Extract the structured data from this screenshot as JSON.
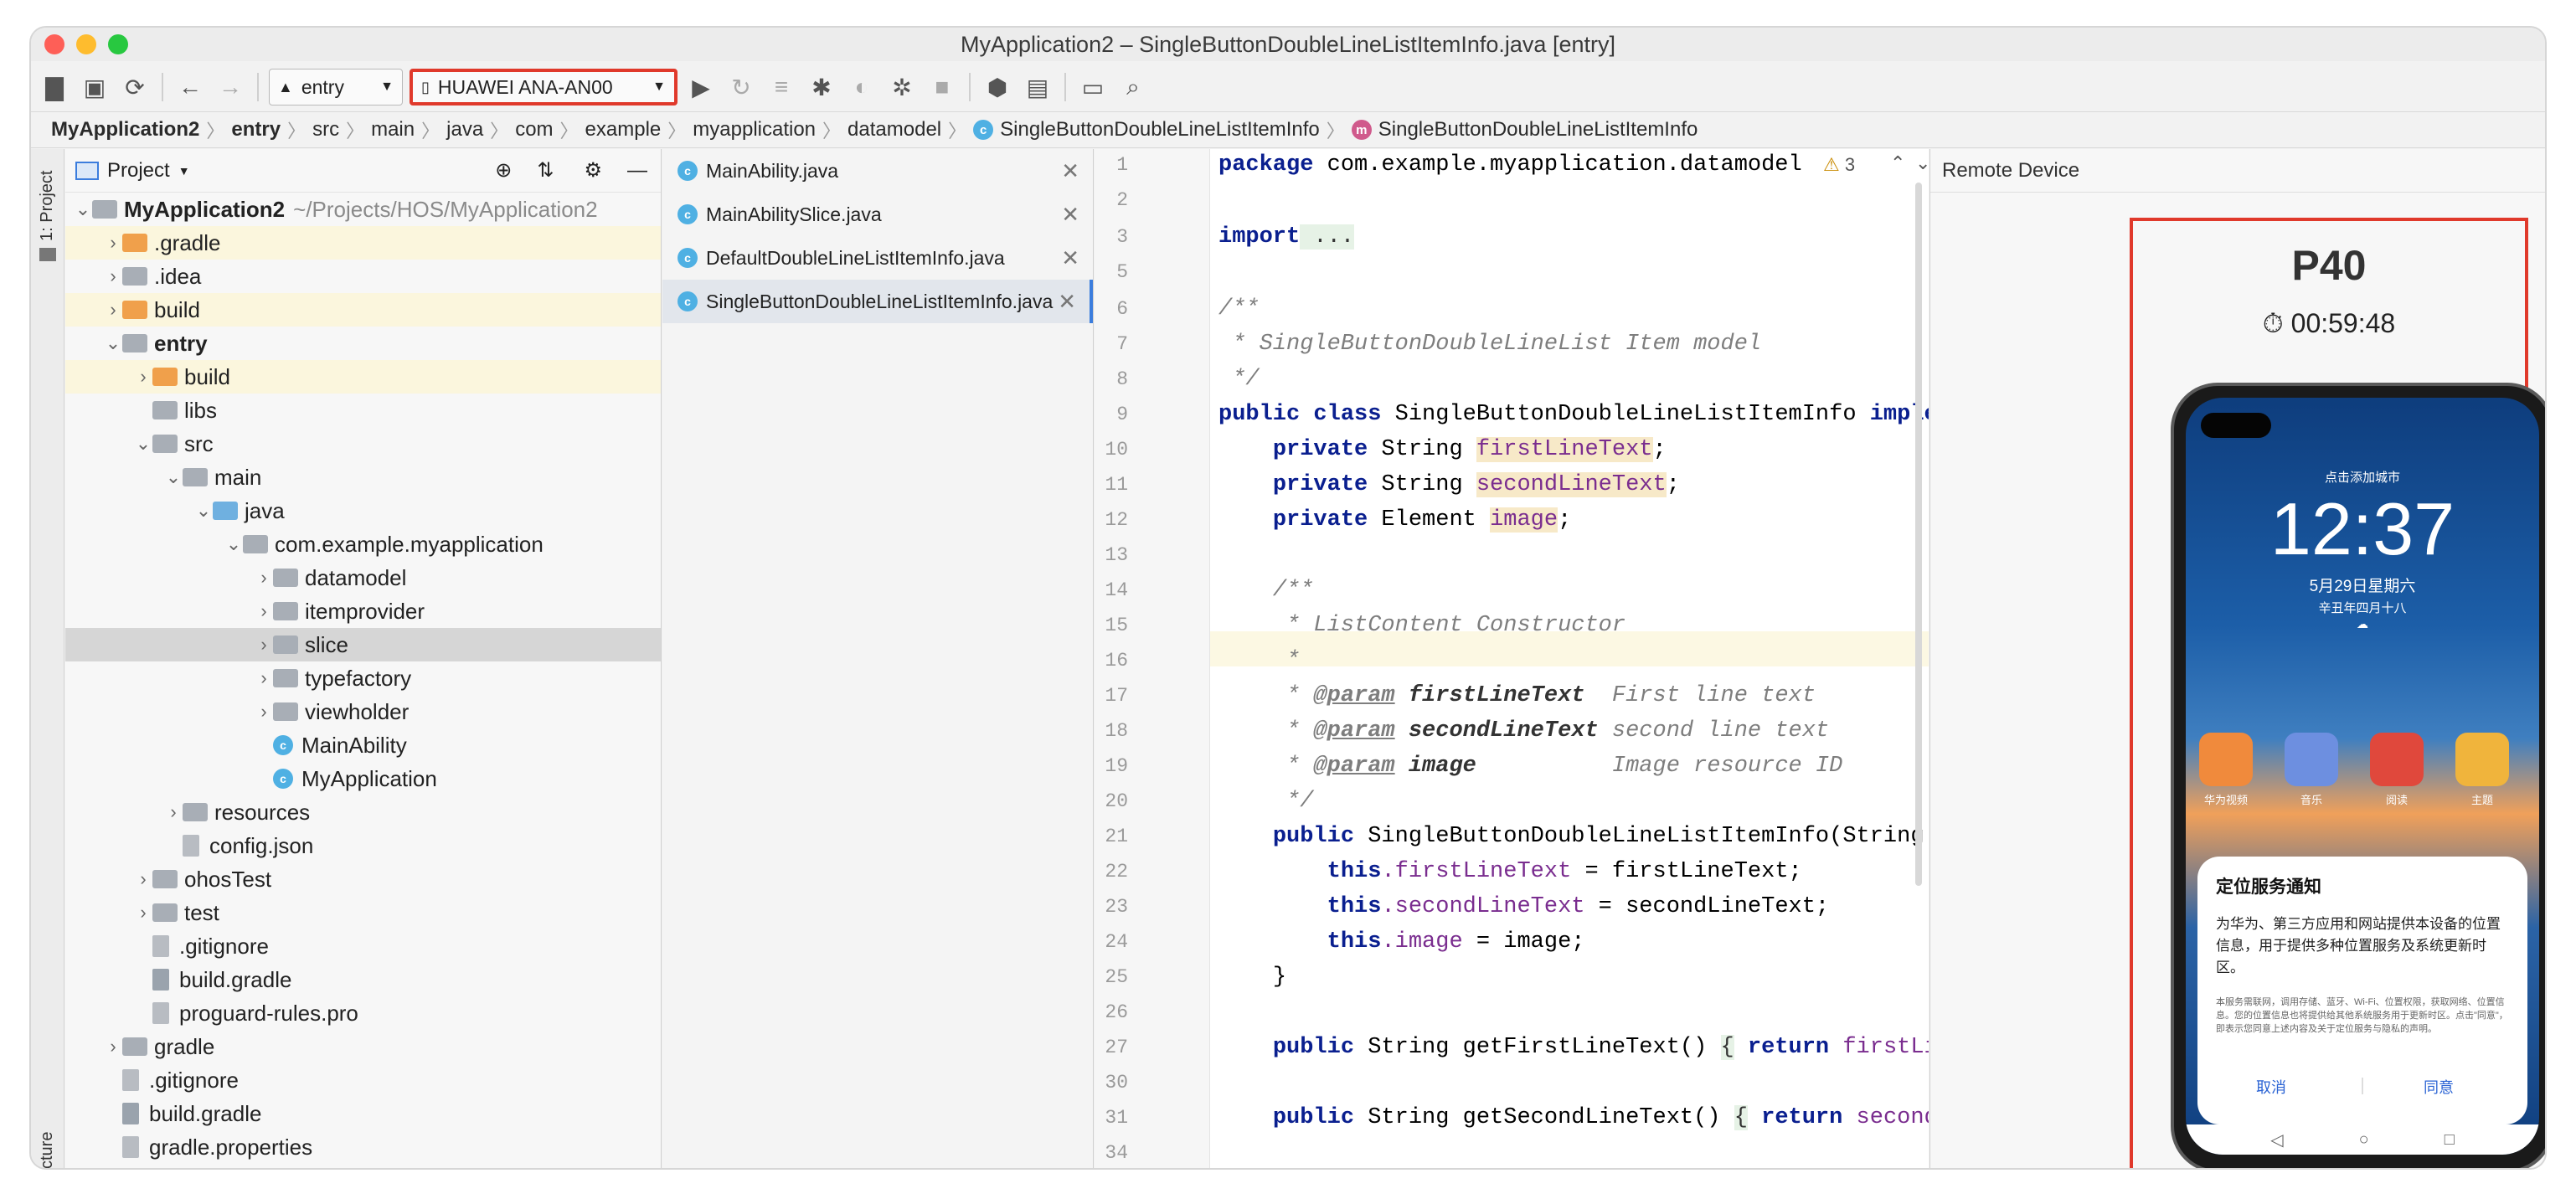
{
  "window": {
    "title": "MyApplication2 – SingleButtonDoubleLineListItemInfo.java [entry]"
  },
  "toolbar": {
    "module_combo": "entry",
    "device_combo": "HUAWEI ANA-AN00"
  },
  "breadcrumb": [
    "MyApplication2",
    "entry",
    "src",
    "main",
    "java",
    "com",
    "example",
    "myapplication",
    "datamodel",
    "SingleButtonDoubleLineListItemInfo",
    "SingleButtonDoubleLineListItemInfo"
  ],
  "sidebar": {
    "project_label": "1: Project",
    "structure_label": "cture"
  },
  "project": {
    "title": "Project",
    "tree": [
      {
        "label": "MyApplication2",
        "note": "~/Projects/HOS/MyApplication2",
        "depth": 0,
        "icon": "module",
        "expanded": true,
        "bold": true
      },
      {
        "label": ".gradle",
        "depth": 1,
        "icon": "folder-orange",
        "collapsed": true,
        "hl": true
      },
      {
        "label": ".idea",
        "depth": 1,
        "icon": "folder-grey",
        "collapsed": true
      },
      {
        "label": "build",
        "depth": 1,
        "icon": "folder-orange",
        "collapsed": true,
        "hl": true
      },
      {
        "label": "entry",
        "depth": 1,
        "icon": "module",
        "expanded": true,
        "bold": true
      },
      {
        "label": "build",
        "depth": 2,
        "icon": "folder-orange",
        "collapsed": true,
        "hl": true
      },
      {
        "label": "libs",
        "depth": 2,
        "icon": "folder-grey"
      },
      {
        "label": "src",
        "depth": 2,
        "icon": "folder-grey",
        "expanded": true
      },
      {
        "label": "main",
        "depth": 3,
        "icon": "folder-grey",
        "expanded": true
      },
      {
        "label": "java",
        "depth": 4,
        "icon": "folder-blue",
        "expanded": true
      },
      {
        "label": "com.example.myapplication",
        "depth": 5,
        "icon": "package",
        "expanded": true
      },
      {
        "label": "datamodel",
        "depth": 6,
        "icon": "package",
        "collapsed": true
      },
      {
        "label": "itemprovider",
        "depth": 6,
        "icon": "package",
        "collapsed": true
      },
      {
        "label": "slice",
        "depth": 6,
        "icon": "package",
        "collapsed": true,
        "sel": true
      },
      {
        "label": "typefactory",
        "depth": 6,
        "icon": "package",
        "collapsed": true
      },
      {
        "label": "viewholder",
        "depth": 6,
        "icon": "package",
        "collapsed": true
      },
      {
        "label": "MainAbility",
        "depth": 6,
        "icon": "class"
      },
      {
        "label": "MyApplication",
        "depth": 6,
        "icon": "class"
      },
      {
        "label": "resources",
        "depth": 3,
        "icon": "folder-grey",
        "collapsed": true
      },
      {
        "label": "config.json",
        "depth": 3,
        "icon": "file"
      },
      {
        "label": "ohosTest",
        "depth": 2,
        "icon": "folder-grey",
        "collapsed": true
      },
      {
        "label": "test",
        "depth": 2,
        "icon": "folder-grey",
        "collapsed": true
      },
      {
        "label": ".gitignore",
        "depth": 2,
        "icon": "file"
      },
      {
        "label": "build.gradle",
        "depth": 2,
        "icon": "gradle"
      },
      {
        "label": "proguard-rules.pro",
        "depth": 2,
        "icon": "file"
      },
      {
        "label": "gradle",
        "depth": 1,
        "icon": "folder-grey",
        "collapsed": true
      },
      {
        "label": ".gitignore",
        "depth": 1,
        "icon": "file"
      },
      {
        "label": "build.gradle",
        "depth": 1,
        "icon": "gradle"
      },
      {
        "label": "gradle.properties",
        "depth": 1,
        "icon": "file"
      }
    ]
  },
  "tabs": [
    {
      "label": "MainAbility.java"
    },
    {
      "label": "MainAbilitySlice.java"
    },
    {
      "label": "DefaultDoubleLineListItemInfo.java"
    },
    {
      "label": "SingleButtonDoubleLineListItemInfo.java",
      "active": true
    }
  ],
  "editor": {
    "inspection_count": "3",
    "lines": [
      {
        "n": "1",
        "html": "package"
      },
      {
        "n": "2"
      },
      {
        "n": "3"
      },
      {
        "n": "5"
      },
      {
        "n": "6"
      },
      {
        "n": "7"
      },
      {
        "n": "8"
      },
      {
        "n": "9"
      },
      {
        "n": "10"
      },
      {
        "n": "11"
      },
      {
        "n": "12"
      },
      {
        "n": "13"
      },
      {
        "n": "14"
      },
      {
        "n": "15"
      },
      {
        "n": "16"
      },
      {
        "n": "17"
      },
      {
        "n": "18"
      },
      {
        "n": "19"
      },
      {
        "n": "20"
      },
      {
        "n": "21"
      },
      {
        "n": "22"
      },
      {
        "n": "23"
      },
      {
        "n": "24"
      },
      {
        "n": "25"
      },
      {
        "n": "26"
      },
      {
        "n": "27"
      },
      {
        "n": "30"
      },
      {
        "n": "31"
      },
      {
        "n": "34"
      }
    ],
    "code": {
      "l1_kw": "package",
      "l1_rest": " com.example.myapplication.datamodel",
      "l3_kw": "import",
      "l3_rest": " ...",
      "l6": "/**",
      "l7": " * SingleButtonDoubleLineList Item model",
      "l8": " */",
      "l9_kw1": "public",
      "l9_kw2": "class",
      "l9_rest": " SingleButtonDoubleLineListItemInfo ",
      "l9_kw3": "imple",
      "l10_kw": "private",
      "l10_type": " String ",
      "l10_f": "firstLineText",
      "l10_end": ";",
      "l11_kw": "private",
      "l11_type": " String ",
      "l11_f": "secondLineText",
      "l11_end": ";",
      "l12_kw": "private",
      "l12_type": " Element ",
      "l12_f": "image",
      "l12_end": ";",
      "l14": "/**",
      "l15": " * ListContent Constructor",
      "l16": " *",
      "l17_star": " * ",
      "l17_tag": "@param",
      "l17_name": " firstLineText",
      "l17_desc": "  First line text",
      "l18_star": " * ",
      "l18_tag": "@param",
      "l18_name": " secondLineText",
      "l18_desc": " second line text",
      "l19_star": " * ",
      "l19_tag": "@param",
      "l19_name": " image",
      "l19_desc": "          Image resource ID",
      "l20": " */",
      "l21_kw": "public",
      "l21_rest": " SingleButtonDoubleLineListItemInfo(String",
      "l22_kw": "this",
      "l22_f": ".firstLineText",
      "l22_rest": " = firstLineText;",
      "l23_kw": "this",
      "l23_f": ".secondLineText",
      "l23_rest": " = secondLineText;",
      "l24_kw": "this",
      "l24_f": ".image",
      "l24_rest": " = image;",
      "l25": "}",
      "l27_kw": "public",
      "l27_rest": " String getFirstLineText() ",
      "l27_b": "{",
      "l27_kw2": " return",
      "l27_f": " firstLi",
      "l31_kw": "public",
      "l31_rest": " String getSecondLineText() ",
      "l31_b": "{",
      "l31_kw2": " return",
      "l31_f": " second"
    }
  },
  "remote": {
    "title": "Remote Device",
    "device_name": "P40",
    "timer": "00:59:48",
    "lock_city": "点击添加城市",
    "lock_time": "12:37",
    "lock_date": "5月29日星期六",
    "lock_lunar": "辛丑年四月十八",
    "apps": [
      {
        "label": "华为视频",
        "color": "#f08a3c"
      },
      {
        "label": "音乐",
        "color": "#6d8fe0"
      },
      {
        "label": "阅读",
        "color": "#e0483c"
      },
      {
        "label": "主题",
        "color": "#f0b43c"
      }
    ],
    "dialog": {
      "title": "定位服务通知",
      "body": "为华为、第三方应用和网站提供本设备的位置信息，用于提供多种位置服务及系统更新时区。",
      "fine": "本服务需联网，调用存储、蓝牙、Wi-Fi、位置权限，获取网络、位置信息。您的位置信息也将提供给其他系统服务用于更新时区。点击\"同意\"，即表示您同意上述内容及关于定位服务与隐私的声明。",
      "cancel": "取消",
      "agree": "同意"
    }
  },
  "colors": {
    "accent_red": "#e0392b",
    "keyword": "#0a1f8f",
    "field": "#7a2d8f",
    "comment": "#7e7e7e"
  }
}
